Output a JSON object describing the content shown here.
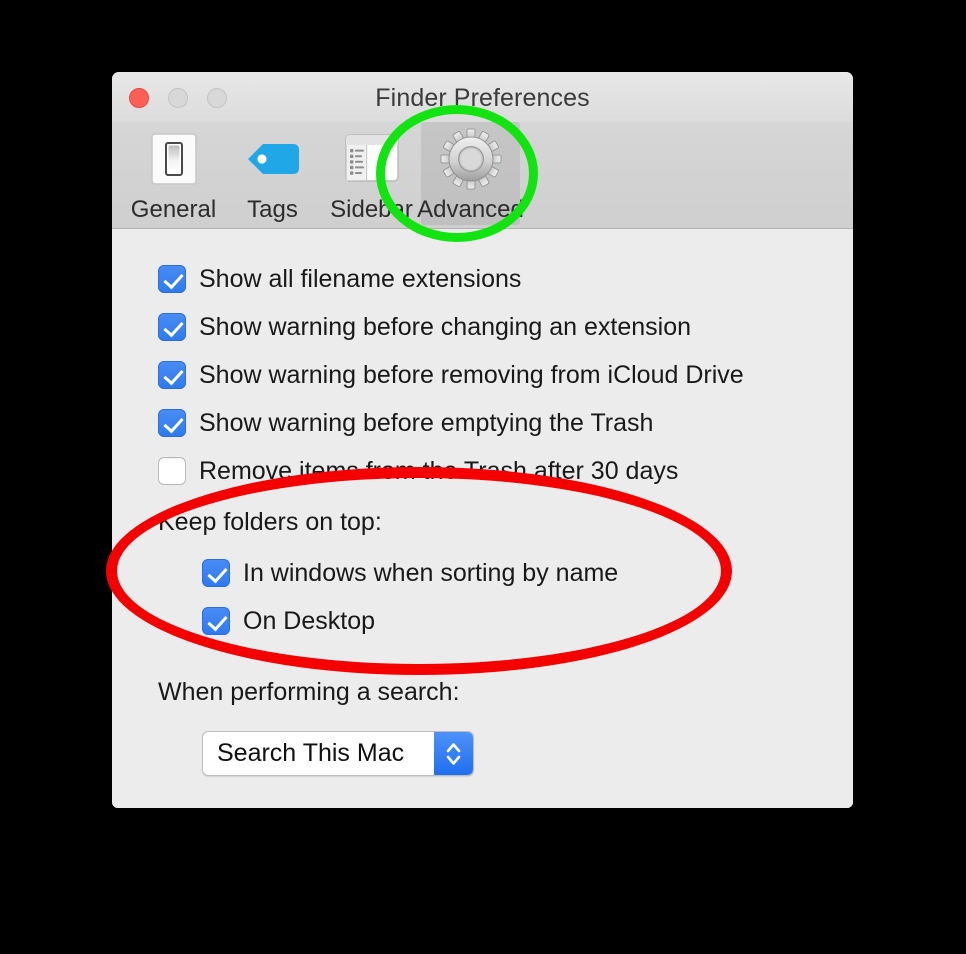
{
  "window": {
    "title": "Finder Preferences",
    "traffic_lights": [
      {
        "name": "close",
        "color": "#ff5f56"
      },
      {
        "name": "minimize",
        "color": "#d8d8d8"
      },
      {
        "name": "zoom",
        "color": "#d8d8d8"
      }
    ]
  },
  "toolbar": {
    "items": [
      {
        "label": "General",
        "icon": "light-switch-icon",
        "selected": false
      },
      {
        "label": "Tags",
        "icon": "tag-icon",
        "selected": false
      },
      {
        "label": "Sidebar",
        "icon": "finder-sidebar-icon",
        "selected": false
      },
      {
        "label": "Advanced",
        "icon": "gear-icon",
        "selected": true
      }
    ]
  },
  "content": {
    "checkboxes": [
      {
        "label": "Show all filename extensions",
        "checked": true
      },
      {
        "label": "Show warning before changing an extension",
        "checked": true
      },
      {
        "label": "Show warning before removing from iCloud Drive",
        "checked": true
      },
      {
        "label": "Show warning before emptying the Trash",
        "checked": true
      },
      {
        "label": "Remove items from the Trash after 30 days",
        "checked": false
      }
    ],
    "keep_folders_on_top": {
      "label": "Keep folders on top:",
      "options": [
        {
          "label": "In windows when sorting by name",
          "checked": true
        },
        {
          "label": "On Desktop",
          "checked": true
        }
      ]
    },
    "search": {
      "label": "When performing a search:",
      "selected_option": "Search This Mac"
    }
  },
  "annotations": {
    "green_circle": {
      "target": "Advanced",
      "color": "#12e412"
    },
    "red_ellipse": {
      "target": "Keep folders on top",
      "color": "#f50000"
    }
  }
}
